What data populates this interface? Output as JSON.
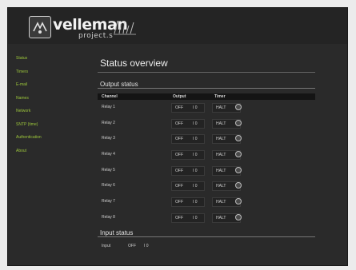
{
  "logo": {
    "word": "velleman",
    "sub": "project.s"
  },
  "sidebar": {
    "items": [
      {
        "label": "Status",
        "name": "sidebar-item-status"
      },
      {
        "label": "Timers",
        "name": "sidebar-item-timers"
      },
      {
        "label": "E-mail",
        "name": "sidebar-item-email"
      },
      {
        "label": "Names",
        "name": "sidebar-item-names"
      },
      {
        "label": "Network",
        "name": "sidebar-item-network"
      },
      {
        "label": "SNTP (time)",
        "name": "sidebar-item-sntp"
      },
      {
        "label": "Authentication",
        "name": "sidebar-item-authentication"
      },
      {
        "label": "About",
        "name": "sidebar-item-about"
      }
    ]
  },
  "main": {
    "title": "Status overview",
    "output_section": "Output status",
    "columns": {
      "channel": "Channel",
      "output": "Output",
      "timer": "Timer"
    },
    "relays": [
      {
        "channel": "Relay 1",
        "output": "OFF",
        "io": "I 0",
        "timer": "HALT"
      },
      {
        "channel": "Relay 2",
        "output": "OFF",
        "io": "I 0",
        "timer": "HALT"
      },
      {
        "channel": "Relay 3",
        "output": "OFF",
        "io": "I 0",
        "timer": "HALT"
      },
      {
        "channel": "Relay 4",
        "output": "OFF",
        "io": "I 0",
        "timer": "HALT"
      },
      {
        "channel": "Relay 5",
        "output": "OFF",
        "io": "I 0",
        "timer": "HALT"
      },
      {
        "channel": "Relay 6",
        "output": "OFF",
        "io": "I 0",
        "timer": "HALT"
      },
      {
        "channel": "Relay 7",
        "output": "OFF",
        "io": "I 0",
        "timer": "HALT"
      },
      {
        "channel": "Relay 8",
        "output": "OFF",
        "io": "I 0",
        "timer": "HALT"
      }
    ],
    "input_section": "Input status",
    "input": {
      "label": "Input",
      "value": "OFF",
      "io": "I 0"
    }
  },
  "colors": {
    "nav_link": "#9cc63b",
    "background": "#2a2a2a",
    "header": "#242424"
  }
}
